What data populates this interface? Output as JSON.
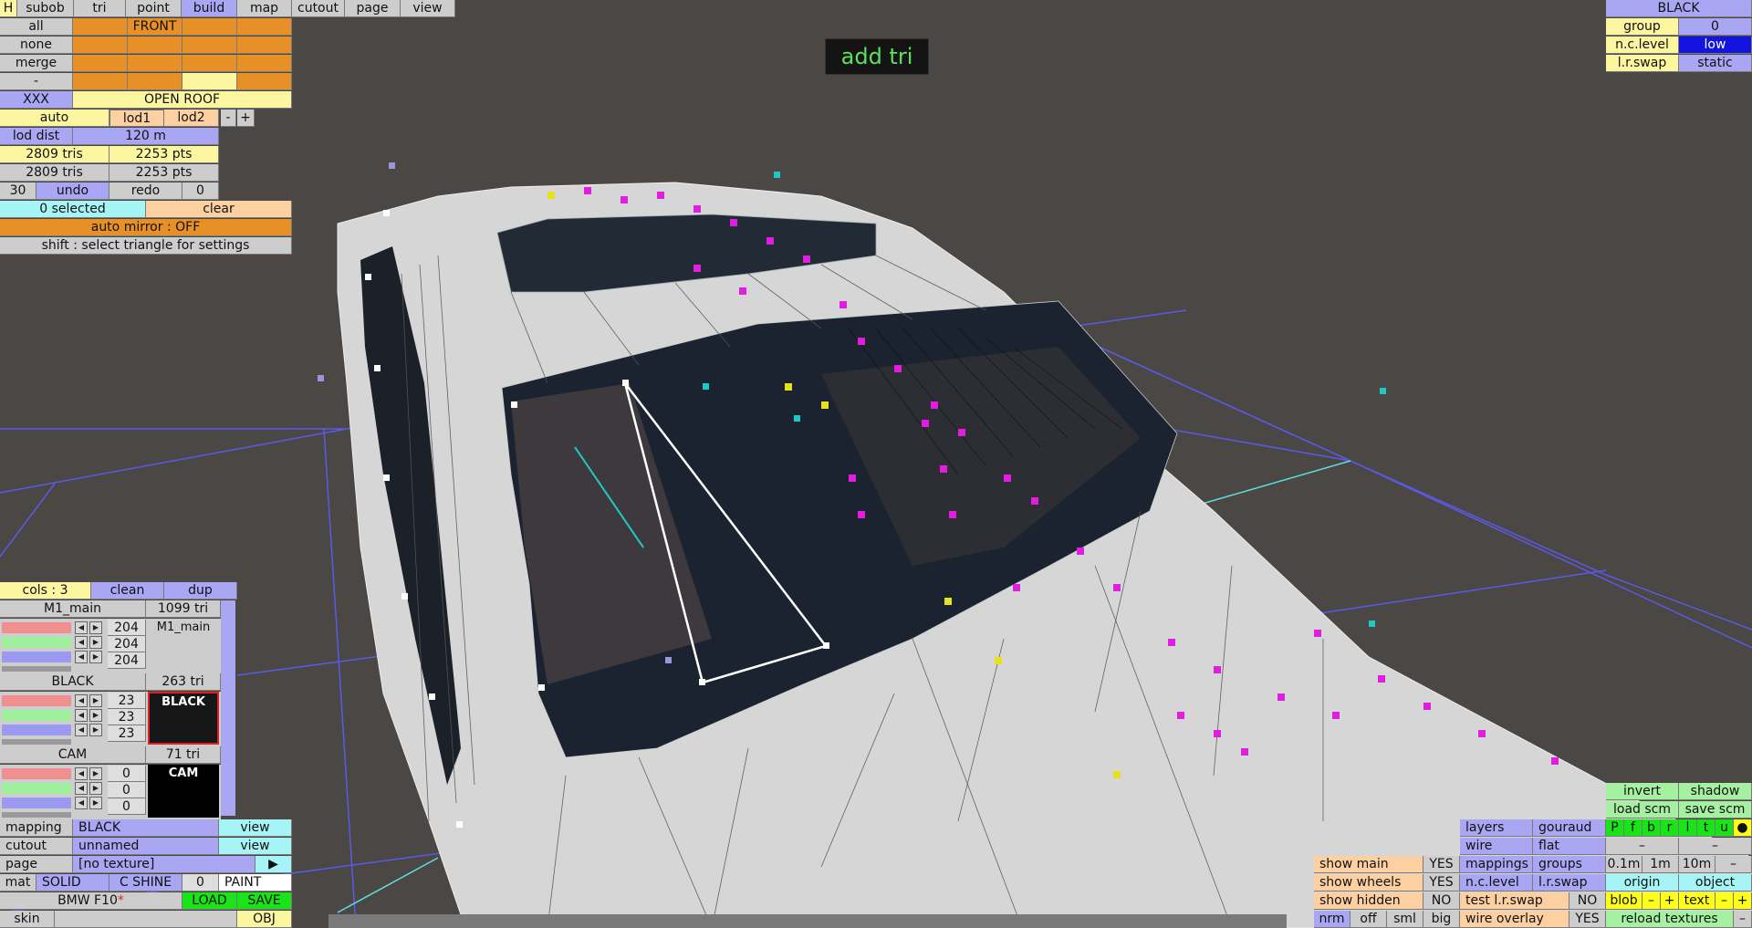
{
  "overlay_message": "add tri",
  "top_tabs": [
    {
      "label": "H",
      "active": false
    },
    {
      "label": "subob",
      "active": false
    },
    {
      "label": "tri",
      "active": false
    },
    {
      "label": "point",
      "active": false
    },
    {
      "label": "build",
      "active": true
    },
    {
      "label": "map",
      "active": false
    },
    {
      "label": "cutout",
      "active": false
    },
    {
      "label": "page",
      "active": false
    },
    {
      "label": "view",
      "active": false
    }
  ],
  "select_rows": [
    "all",
    "none",
    "merge",
    "-"
  ],
  "front_label": "FRONT",
  "xxx_label": "XXX",
  "open_roof_label": "OPEN ROOF",
  "lod": {
    "auto": "auto",
    "lod1": "lod1",
    "lod2": "lod2",
    "minus": "-",
    "plus": "+"
  },
  "lod_dist": {
    "label": "lod dist",
    "value": "120 m"
  },
  "stats": [
    {
      "tris": "2809 tris",
      "pts": "2253 pts"
    },
    {
      "tris": "2809 tris",
      "pts": "2253 pts"
    }
  ],
  "undo": {
    "count": "30",
    "undo": "undo",
    "redo": "redo",
    "redo_count": "0"
  },
  "selection": {
    "selected": "0 selected",
    "clear": "clear"
  },
  "auto_mirror": "auto mirror : OFF",
  "hint": "shift : select triangle for settings",
  "top_right": {
    "title": "BLACK",
    "rows": [
      {
        "label": "group",
        "value": "0"
      },
      {
        "label": "n.c.level",
        "value": "low"
      },
      {
        "label": "l.r.swap",
        "value": "static"
      }
    ]
  },
  "colors_panel": {
    "cols": "cols : 3",
    "clean": "clean",
    "dup": "dup",
    "materials": [
      {
        "name": "M1_main",
        "tris": "1099 tri",
        "rgb": [
          "204",
          "204",
          "204"
        ],
        "swatch_label": "M1_main",
        "swatch_color": "#cccccc"
      },
      {
        "name": "BLACK",
        "tris": "263 tri",
        "rgb": [
          "23",
          "23",
          "23"
        ],
        "swatch_label": "BLACK",
        "swatch_color": "#171717"
      },
      {
        "name": "CAM",
        "tris": "71 tri",
        "rgb": [
          "0",
          "0",
          "0"
        ],
        "swatch_label": "CAM",
        "swatch_color": "#000000"
      }
    ]
  },
  "mapping": {
    "label": "mapping",
    "value": "BLACK",
    "view": "view"
  },
  "cutout": {
    "label": "cutout",
    "value": "unnamed",
    "view": "view"
  },
  "page": {
    "label": "page",
    "value": "[no texture]",
    "arrow": "▶"
  },
  "mat": {
    "label": "mat",
    "solid": "SOLID",
    "shine": "C SHINE",
    "shine_val": "0",
    "paint": "PAINT"
  },
  "file": {
    "name": "BMW F10",
    "modified_mark": "*",
    "load": "LOAD",
    "save": "SAVE"
  },
  "skin": {
    "label": "skin",
    "obj": "OBJ"
  },
  "bottom_right": {
    "invert": "invert",
    "shadow": "shadow",
    "load_scm": "load scm",
    "save_scm": "save scm",
    "view_letters": [
      "P",
      "f",
      "b",
      "r",
      "l",
      "t",
      "u",
      "●"
    ],
    "layers": "layers",
    "gouraud": "gouraud",
    "wire": "wire",
    "flat": "flat",
    "dash1": "–",
    "dash2": "–",
    "show_main": "show main",
    "show_main_v": "YES",
    "mappings": "mappings",
    "groups": "groups",
    "grid": [
      "0.1m",
      "1m",
      "10m",
      "–"
    ],
    "show_wheels": "show wheels",
    "show_wheels_v": "YES",
    "ncl": "n.c.level",
    "lrswap": "l.r.swap",
    "origin": "origin",
    "object": "object",
    "show_hidden": "show hidden",
    "show_hidden_v": "NO",
    "test_lr": "test l.r.swap",
    "test_lr_v": "NO",
    "blob": "blob",
    "text": "text",
    "minus": "–",
    "plus": "+",
    "nrm": "nrm",
    "off": "off",
    "sml": "sml",
    "big": "big",
    "wire_overlay": "wire overlay",
    "wire_overlay_v": "YES",
    "reload": "reload textures",
    "reload_minus": "–"
  },
  "colors": {
    "background": "#4a4744",
    "car_body": "#d6d6d6",
    "glass": "#1b2330",
    "vertex_magenta": "#e01ee0",
    "vertex_yellow": "#e8e020",
    "vertex_cyan": "#1ec8c8",
    "grid_line": "#5a5ae6"
  }
}
